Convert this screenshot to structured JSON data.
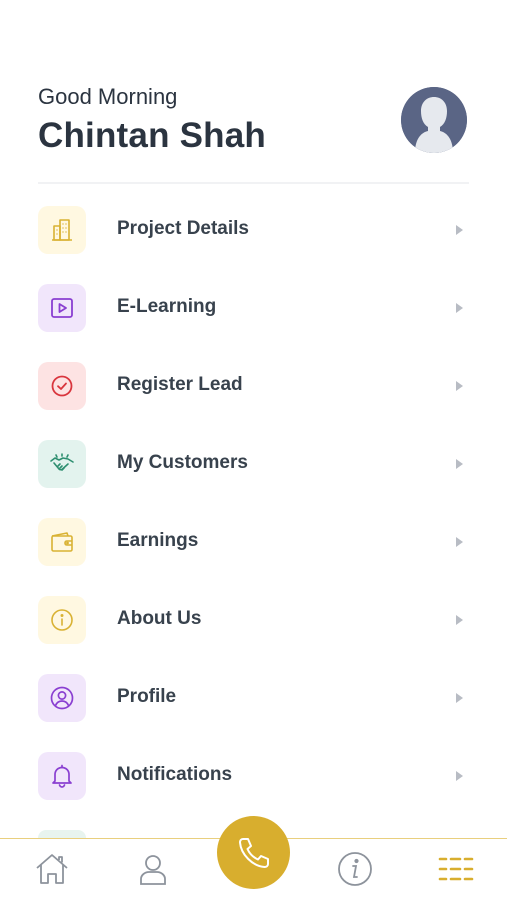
{
  "header": {
    "greeting": "Good Morning",
    "user_name": "Chintan Shah"
  },
  "menu": {
    "items": [
      {
        "label": "Project Details",
        "icon": "buildings-icon",
        "bg": "#fff8e1",
        "fg": "#d9b233"
      },
      {
        "label": "E-Learning",
        "icon": "video-play-icon",
        "bg": "#f1e6fb",
        "fg": "#8a3fd1"
      },
      {
        "label": "Register Lead",
        "icon": "check-circle-icon",
        "bg": "#fde3e3",
        "fg": "#d9363e"
      },
      {
        "label": "My Customers",
        "icon": "handshake-icon",
        "bg": "#e3f3ee",
        "fg": "#2e8f70"
      },
      {
        "label": "Earnings",
        "icon": "wallet-icon",
        "bg": "#fff8e1",
        "fg": "#d9b233"
      },
      {
        "label": "About Us",
        "icon": "info-circle-icon",
        "bg": "#fff8e1",
        "fg": "#d9b233"
      },
      {
        "label": "Profile",
        "icon": "user-circle-icon",
        "bg": "#f1e6fb",
        "fg": "#8a3fd1"
      },
      {
        "label": "Notifications",
        "icon": "bell-icon",
        "bg": "#f1e6fb",
        "fg": "#8a3fd1"
      }
    ]
  },
  "bottom_nav": {
    "items": [
      "home-icon",
      "user-icon",
      "phone-call-icon",
      "info-icon",
      "menu-grid-icon"
    ],
    "accent": "#d8ae2e",
    "inactive": "#8d939c"
  }
}
